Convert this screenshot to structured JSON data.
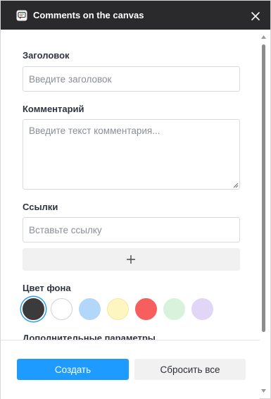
{
  "window": {
    "title": "Comments on the canvas"
  },
  "form": {
    "title_field": {
      "label": "Заголовок",
      "placeholder": "Введите заголовок",
      "value": ""
    },
    "comment_field": {
      "label": "Комментарий",
      "placeholder": "Введите текст комментария...",
      "value": ""
    },
    "links_field": {
      "label": "Ссылки",
      "placeholder": "Вставьте ссылку",
      "value": ""
    },
    "add_link_icon": "plus-icon",
    "background_color": {
      "label": "Цвет фона",
      "selected_index": 0,
      "swatches": [
        {
          "name": "black",
          "color": "#3b3b3b"
        },
        {
          "name": "white",
          "color": "#ffffff"
        },
        {
          "name": "blue",
          "color": "#b3d7fb"
        },
        {
          "name": "yellow",
          "color": "#fdf6c1"
        },
        {
          "name": "red",
          "color": "#f75e5e"
        },
        {
          "name": "green",
          "color": "#d8f2dc"
        },
        {
          "name": "purple",
          "color": "#e2d6f7"
        }
      ]
    },
    "advanced_label": "Дополнительные параметры"
  },
  "footer": {
    "create_label": "Создать",
    "reset_label": "Сбросить все"
  },
  "colors": {
    "titlebar": "#2a2a2c",
    "accent": "#1e9bff",
    "secondary_button": "#f1f1f1",
    "selection_ring": "#2a9bf0"
  }
}
